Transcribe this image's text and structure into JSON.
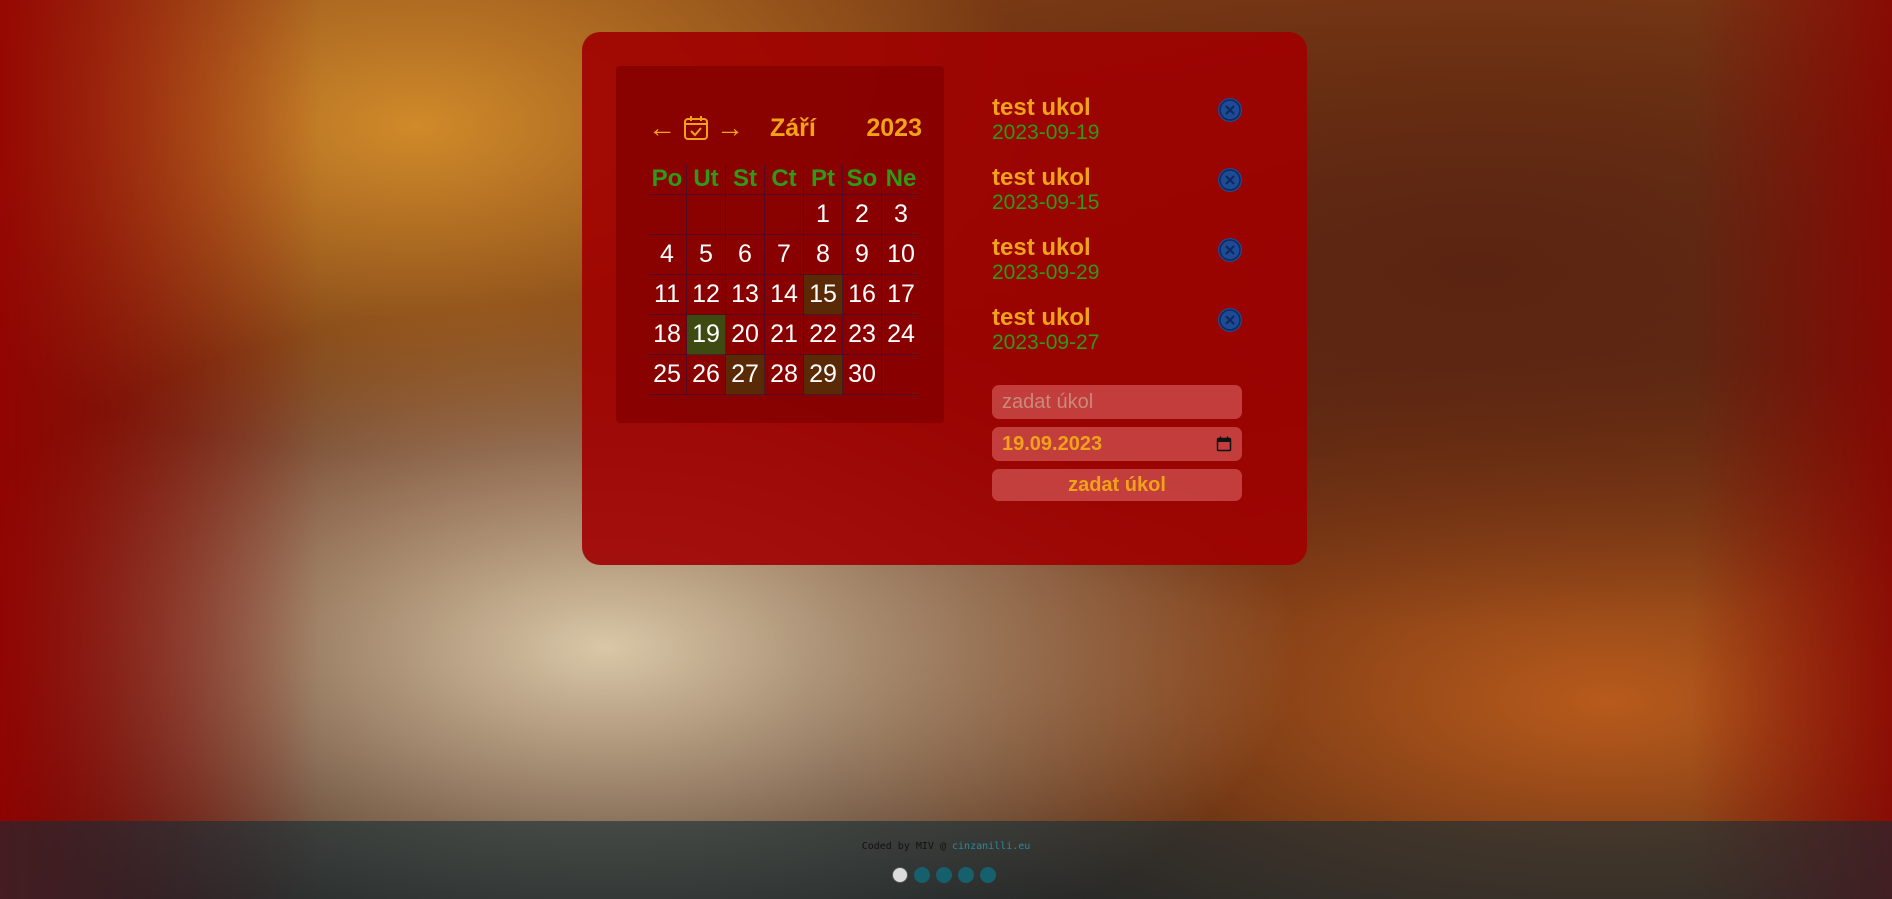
{
  "calendar": {
    "month": "Září",
    "year": "2023",
    "weekdays": [
      "Po",
      "Ut",
      "St",
      "Ct",
      "Pt",
      "So",
      "Ne"
    ],
    "weeks": [
      [
        "",
        "",
        "",
        "",
        "1",
        "2",
        "3"
      ],
      [
        "4",
        "5",
        "6",
        "7",
        "8",
        "9",
        "10"
      ],
      [
        "11",
        "12",
        "13",
        "14",
        "15",
        "16",
        "17"
      ],
      [
        "18",
        "19",
        "20",
        "21",
        "22",
        "23",
        "24"
      ],
      [
        "25",
        "26",
        "27",
        "28",
        "29",
        "30",
        ""
      ]
    ],
    "selected_day": "19",
    "task_days": [
      "15",
      "27",
      "29"
    ]
  },
  "tasks": [
    {
      "name": "test ukol",
      "date": "2023-09-19"
    },
    {
      "name": "test ukol",
      "date": "2023-09-15"
    },
    {
      "name": "test ukol",
      "date": "2023-09-29"
    },
    {
      "name": "test ukol",
      "date": "2023-09-27"
    }
  ],
  "form": {
    "task_placeholder": "zadat úkol",
    "date_value": "19.09.2023",
    "submit_label": "zadat úkol"
  },
  "footer": {
    "credit_prefix": "Coded by MIV @",
    "credit_link": "cinzanilli.eu"
  },
  "colors": {
    "accent": "#f0a21a",
    "green": "#2f9a16",
    "panel": "#a00000"
  }
}
